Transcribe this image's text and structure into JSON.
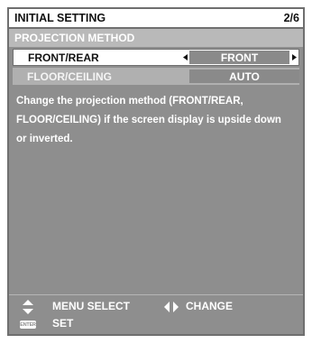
{
  "header": {
    "title": "INITIAL SETTING",
    "page": "2/6"
  },
  "section": {
    "title": "PROJECTION METHOD"
  },
  "settings": [
    {
      "label": "FRONT/REAR",
      "value": "FRONT",
      "selected": true
    },
    {
      "label": "FLOOR/CEILING",
      "value": "AUTO",
      "selected": false
    }
  ],
  "description": {
    "lines": [
      "Change the projection method (FRONT/REAR,",
      "FLOOR/CEILING) if the screen display is upside down",
      "or inverted."
    ]
  },
  "footer": {
    "menu_select": "MENU SELECT",
    "change": "CHANGE",
    "set": "SET",
    "enter_icon_text": "ENTER"
  },
  "icons": {
    "left_arrow": "left-triangle-icon",
    "right_arrow": "right-triangle-icon",
    "updown": "up-down-arrows-icon",
    "leftright": "left-right-arrows-icon",
    "enter": "enter-key-icon"
  },
  "colors": {
    "panel": "#8e8e8e",
    "section_header": "#b9b9b9",
    "value_box": "#8a8a8a",
    "frame": "#6f6f6f"
  }
}
